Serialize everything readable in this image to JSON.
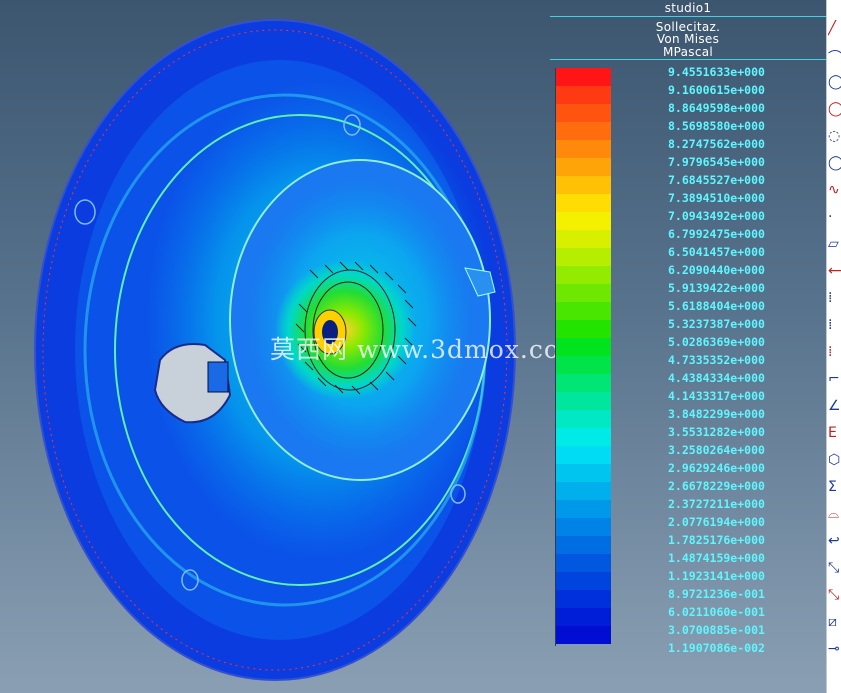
{
  "legend": {
    "title": "studio1",
    "lines": [
      "Sollecitaz.",
      "Von Mises",
      "MPascal"
    ],
    "labels": [
      "9.4551633e+000",
      "9.1600615e+000",
      "8.8649598e+000",
      "8.5698580e+000",
      "8.2747562e+000",
      "7.9796545e+000",
      "7.6845527e+000",
      "7.3894510e+000",
      "7.0943492e+000",
      "6.7992475e+000",
      "6.5041457e+000",
      "6.2090440e+000",
      "5.9139422e+000",
      "5.6188404e+000",
      "5.3237387e+000",
      "5.0286369e+000",
      "4.7335352e+000",
      "4.4384334e+000",
      "4.1433317e+000",
      "3.8482299e+000",
      "3.5531282e+000",
      "3.2580264e+000",
      "2.9629246e+000",
      "2.6678229e+000",
      "2.3727211e+000",
      "2.0776194e+000",
      "1.7825176e+000",
      "1.4874159e+000",
      "1.1923141e+000",
      "8.9721236e-001",
      "6.0211060e-001",
      "3.0700885e-001",
      "1.1907086e-002"
    ],
    "colors": [
      "#ff1515",
      "#ff3a12",
      "#ff5410",
      "#ff6d0e",
      "#ff890b",
      "#ffa408",
      "#ffc005",
      "#ffdd03",
      "#f5ef00",
      "#d8f000",
      "#b6ee00",
      "#93ec00",
      "#6ee800",
      "#48e600",
      "#22e400",
      "#00e31d",
      "#00e44a",
      "#00e573",
      "#00e69d",
      "#00e8c4",
      "#00eae6",
      "#00dcf3",
      "#00c6ef",
      "#00b0ec",
      "#0099e9",
      "#0083e6",
      "#006de3",
      "#0058e1",
      "#0044df",
      "#0030dc",
      "#001ed8",
      "#000ed4"
    ]
  },
  "watermark": "莫西网 www.3dmox.com",
  "toolbar": {
    "icons": [
      "line-tool-icon",
      "arc-tool-icon",
      "circle-tool-icon",
      "circle-tool-icon",
      "circle-3pt-icon",
      "ellipse-tool-icon",
      "spline-tool-icon",
      "point-tool-icon",
      "rectangle-tool-icon",
      "dimension-tool-icon",
      "node-tool-icon",
      "node-tool-icon",
      "node-tool-icon",
      "trim-tool-icon",
      "chamfer-tool-icon",
      "e-tool-icon",
      "polygon-tool-icon",
      "sigma-tool-icon",
      "fillet-tool-icon",
      "hook-tool-icon",
      "offset-tool-icon",
      "offset-tool-icon",
      "mirror-tool-icon",
      "measure-tool-icon"
    ]
  }
}
